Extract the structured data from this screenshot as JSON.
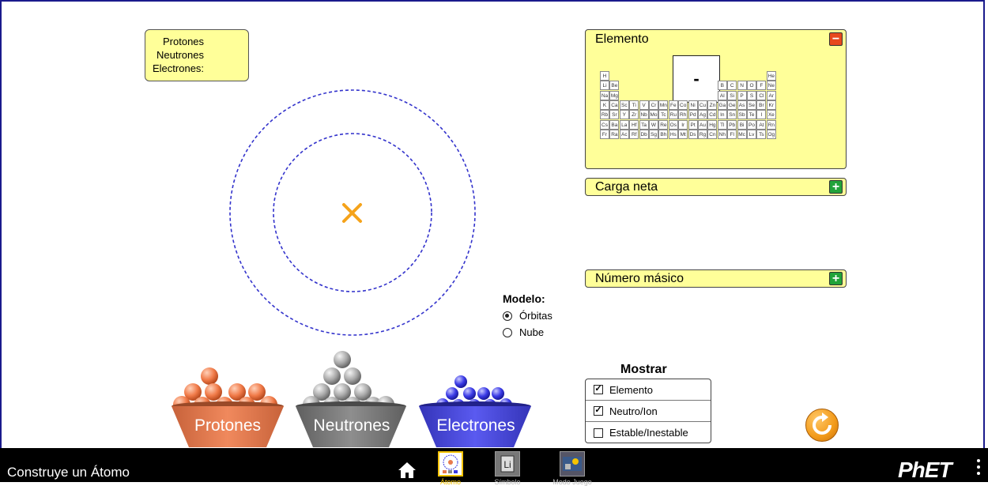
{
  "particle_counts": {
    "protons_label": "Protones",
    "neutrons_label": "Neutrones",
    "electrons_label": "Electrones:"
  },
  "element_panel": {
    "title": "Elemento",
    "collapse_symbol": "−",
    "current_symbol": "-",
    "periodic_table": {
      "row1": [
        "H",
        "",
        "",
        "",
        "",
        "",
        "",
        "",
        "",
        "",
        "",
        "",
        "",
        "",
        "",
        "",
        "",
        "He"
      ],
      "row2": [
        "Li",
        "Be",
        "",
        "",
        "",
        "",
        "",
        "",
        "",
        "",
        "",
        "",
        "B",
        "C",
        "N",
        "O",
        "F",
        "Ne"
      ],
      "row3": [
        "Na",
        "Mg",
        "",
        "",
        "",
        "",
        "",
        "",
        "",
        "",
        "",
        "",
        "Al",
        "Si",
        "P",
        "S",
        "Cl",
        "Ar"
      ],
      "row4": [
        "K",
        "Ca",
        "Sc",
        "Ti",
        "V",
        "Cr",
        "Mn",
        "Fe",
        "Co",
        "Ni",
        "Cu",
        "Zn",
        "Ga",
        "Ge",
        "As",
        "Se",
        "Br",
        "Kr"
      ],
      "row5": [
        "Rb",
        "Sr",
        "Y",
        "Zr",
        "Nb",
        "Mo",
        "Tc",
        "Ru",
        "Rh",
        "Pd",
        "Ag",
        "Cd",
        "In",
        "Sn",
        "Sb",
        "Te",
        "I",
        "Xe"
      ],
      "row6": [
        "Cs",
        "Ba",
        "La",
        "Hf",
        "Ta",
        "W",
        "Re",
        "Os",
        "Ir",
        "Pt",
        "Au",
        "Hg",
        "Tl",
        "Pb",
        "Bi",
        "Po",
        "At",
        "Rn"
      ],
      "row7": [
        "Fr",
        "Ra",
        "Ac",
        "Rf",
        "Db",
        "Sg",
        "Bh",
        "Hs",
        "Mt",
        "Ds",
        "Rg",
        "Cn",
        "Nh",
        "Fl",
        "Mc",
        "Lv",
        "Ts",
        "Og"
      ]
    }
  },
  "net_charge_panel": {
    "title": "Carga neta",
    "expand_symbol": "+"
  },
  "mass_number_panel": {
    "title": "Número másico",
    "expand_symbol": "+"
  },
  "model": {
    "title": "Modelo:",
    "options": [
      {
        "label": "Órbitas",
        "selected": true
      },
      {
        "label": "Nube",
        "selected": false
      }
    ]
  },
  "show": {
    "title": "Mostrar",
    "options": [
      {
        "label": "Elemento",
        "checked": true
      },
      {
        "label": "Neutro/Ion",
        "checked": true
      },
      {
        "label": "Estable/Inestable",
        "checked": false
      }
    ]
  },
  "buckets": {
    "protons": {
      "label": "Protones",
      "color": "#e87a4d"
    },
    "neutrons": {
      "label": "Neutrones",
      "color": "#8c8c8c"
    },
    "electrons": {
      "label": "Electrones",
      "color": "#4a4ae0"
    }
  },
  "nucleus_marker_color": "#f5a31a",
  "orbit_color": "#3333cc",
  "navbar": {
    "sim_title": "Construye un Átomo",
    "tabs": [
      {
        "label": "Átomo",
        "icon": "atom-icon",
        "selected": true
      },
      {
        "label": "Símbolo",
        "icon": "symbol-icon",
        "selected": false
      },
      {
        "label": "Modo Juego",
        "icon": "game-icon",
        "selected": false
      }
    ],
    "brand": "PhET"
  }
}
